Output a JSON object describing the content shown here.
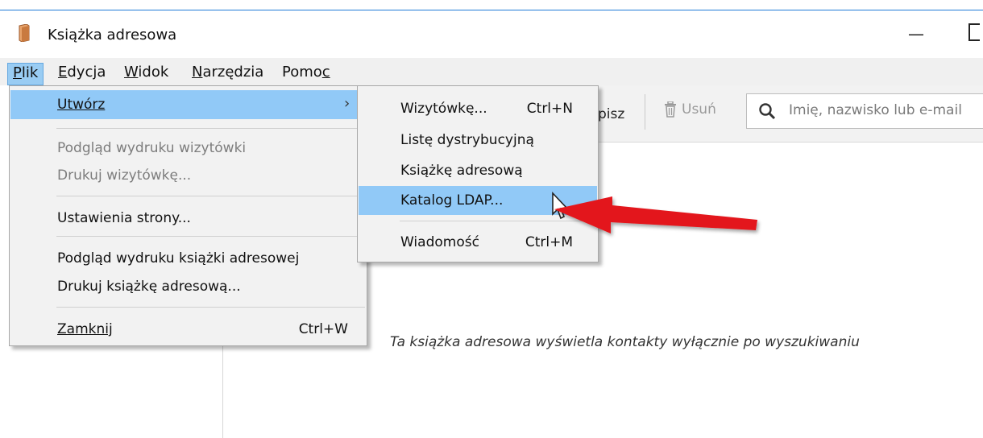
{
  "window": {
    "title": "Książka adresowa",
    "min_glyph": "—"
  },
  "menubar": {
    "items": [
      {
        "label": "Plik",
        "key_index": 0
      },
      {
        "label": "Edycja",
        "key_index": 0
      },
      {
        "label": "Widok",
        "key_index": 0
      },
      {
        "label": "Narzędzia",
        "key_index": 0
      },
      {
        "label": "Pomoc",
        "key_index": 4
      }
    ]
  },
  "toolbar": {
    "partial_label": "pisz",
    "delete_label": "Usuń",
    "search_placeholder": "Imię, nazwisko lub e-mail"
  },
  "file_menu": {
    "create": "Utwórz",
    "print_preview_card": "Podgląd wydruku wizytówki",
    "print_card": "Drukuj wizytówkę...",
    "page_setup": "Ustawienia strony...",
    "print_preview_book": "Podgląd wydruku książki adresowej",
    "print_book": "Drukuj książkę adresową...",
    "close": "Zamknij",
    "close_shortcut": "Ctrl+W"
  },
  "create_submenu": {
    "card": "Wizytówkę...",
    "card_shortcut": "Ctrl+N",
    "list": "Listę dystrybucyjną",
    "book": "Książkę adresową",
    "ldap": "Katalog LDAP...",
    "message": "Wiadomość",
    "message_shortcut": "Ctrl+M"
  },
  "main": {
    "empty_message": "Ta książka adresowa wyświetla kontakty wyłącznie po wyszukiwaniu"
  },
  "colors": {
    "highlight": "#91c9f7",
    "annotation_arrow": "#e3191d"
  }
}
